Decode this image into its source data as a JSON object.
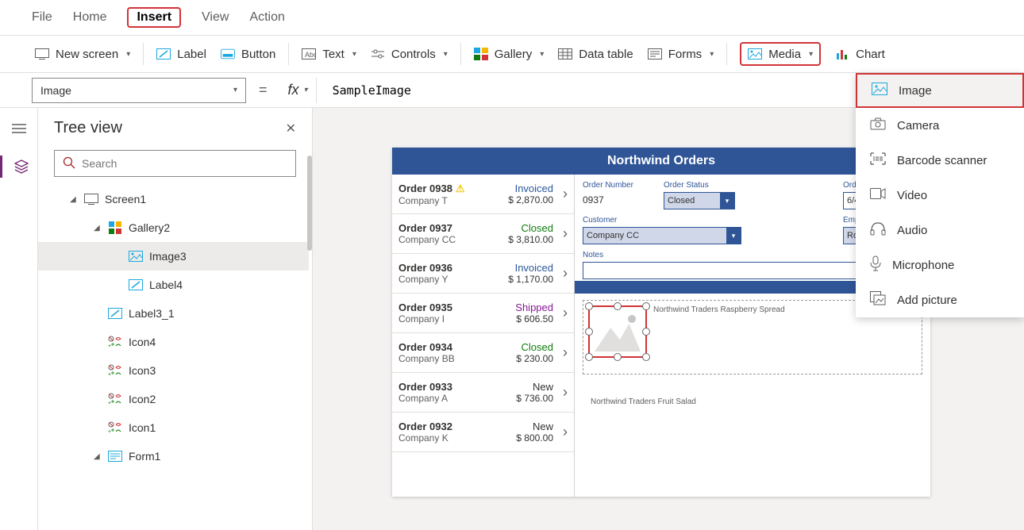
{
  "menu": {
    "file": "File",
    "home": "Home",
    "insert": "Insert",
    "view": "View",
    "action": "Action"
  },
  "ribbon": {
    "newScreen": "New screen",
    "label": "Label",
    "button": "Button",
    "text": "Text",
    "controls": "Controls",
    "gallery": "Gallery",
    "dataTable": "Data table",
    "forms": "Forms",
    "media": "Media",
    "charts": "Chart"
  },
  "propSelector": "Image",
  "formula": "SampleImage",
  "tree": {
    "title": "Tree view",
    "searchPlaceholder": "Search",
    "items": [
      {
        "label": "Screen1",
        "icon": "screen",
        "indent": 1,
        "expanded": true
      },
      {
        "label": "Gallery2",
        "icon": "gallery",
        "indent": 2,
        "expanded": true
      },
      {
        "label": "Image3",
        "icon": "image",
        "indent": 3,
        "selected": true
      },
      {
        "label": "Label4",
        "icon": "label",
        "indent": 3
      },
      {
        "label": "Label3_1",
        "icon": "label",
        "indent": 2
      },
      {
        "label": "Icon4",
        "icon": "icon",
        "indent": 2
      },
      {
        "label": "Icon3",
        "icon": "icon",
        "indent": 2
      },
      {
        "label": "Icon2",
        "icon": "icon",
        "indent": 2
      },
      {
        "label": "Icon1",
        "icon": "icon",
        "indent": 2
      },
      {
        "label": "Form1",
        "icon": "form",
        "indent": 2,
        "expanded": true
      }
    ]
  },
  "app": {
    "title": "Northwind Orders",
    "orders": [
      {
        "name": "Order 0938",
        "company": "Company T",
        "status": "Invoiced",
        "statusClass": "st-invoiced",
        "price": "$ 2,870.00",
        "warn": true
      },
      {
        "name": "Order 0937",
        "company": "Company CC",
        "status": "Closed",
        "statusClass": "st-closed",
        "price": "$ 3,810.00"
      },
      {
        "name": "Order 0936",
        "company": "Company Y",
        "status": "Invoiced",
        "statusClass": "st-invoiced",
        "price": "$ 1,170.00"
      },
      {
        "name": "Order 0935",
        "company": "Company I",
        "status": "Shipped",
        "statusClass": "st-shipped",
        "price": "$ 606.50"
      },
      {
        "name": "Order 0934",
        "company": "Company BB",
        "status": "Closed",
        "statusClass": "st-closed",
        "price": "$ 230.00"
      },
      {
        "name": "Order 0933",
        "company": "Company A",
        "status": "New",
        "statusClass": "st-new",
        "price": "$ 736.00"
      },
      {
        "name": "Order 0932",
        "company": "Company K",
        "status": "New",
        "statusClass": "st-new",
        "price": "$ 800.00"
      }
    ],
    "detail": {
      "orderNumberLabel": "Order Number",
      "orderNumber": "0937",
      "orderStatusLabel": "Order Status",
      "orderStatus": "Closed",
      "orderDateLabel": "Order Date",
      "orderDate": "6/4/2006",
      "customerLabel": "Customer",
      "customer": "Company CC",
      "employeeLabel": "Employee",
      "employee": "Rossi",
      "notesLabel": "Notes",
      "notes": "",
      "product1": "Northwind Traders Raspberry Spread",
      "product2": "Northwind Traders Fruit Salad"
    }
  },
  "mediaMenu": {
    "image": "Image",
    "camera": "Camera",
    "barcode": "Barcode scanner",
    "video": "Video",
    "audio": "Audio",
    "microphone": "Microphone",
    "addPicture": "Add picture"
  }
}
